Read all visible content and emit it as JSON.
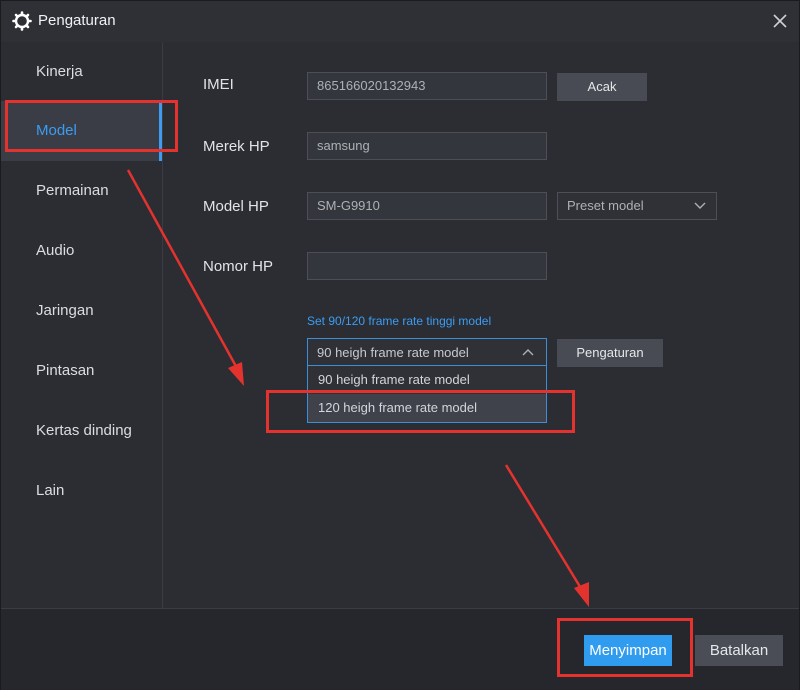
{
  "window": {
    "title": "Pengaturan",
    "icon": "gear-icon",
    "close_icon": "close-icon"
  },
  "sidebar": {
    "items": [
      {
        "label": "Kinerja"
      },
      {
        "label": "Model",
        "active": true
      },
      {
        "label": "Permainan"
      },
      {
        "label": "Audio"
      },
      {
        "label": "Jaringan"
      },
      {
        "label": "Pintasan"
      },
      {
        "label": "Kertas dinding"
      },
      {
        "label": "Lain"
      }
    ]
  },
  "form": {
    "imei": {
      "label": "IMEI",
      "value": "865166020132943",
      "button": "Acak"
    },
    "brand": {
      "label": "Merek HP",
      "value": "samsung"
    },
    "model": {
      "label": "Model HP",
      "value": "SM-G9910",
      "preset": "Preset model"
    },
    "phone": {
      "label": "Nomor HP",
      "value": ""
    },
    "framerate": {
      "link": "Set 90/120 frame rate tinggi model",
      "selected": "90 heigh frame rate model",
      "options": [
        "90 heigh frame rate model",
        "120 heigh frame rate  model"
      ],
      "settings_button": "Pengaturan"
    }
  },
  "footer": {
    "save": "Menyimpan",
    "cancel": "Batalkan"
  },
  "colors": {
    "accent": "#2f9cf0",
    "annotation": "#e4332e",
    "background": "#2b2d33"
  }
}
